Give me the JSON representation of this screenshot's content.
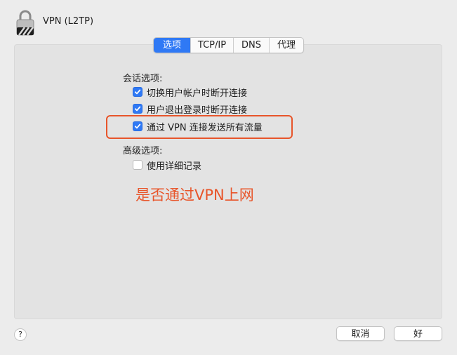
{
  "window": {
    "title": "VPN (L2TP)"
  },
  "tabs": [
    {
      "label": "选项",
      "active": true
    },
    {
      "label": "TCP/IP",
      "active": false
    },
    {
      "label": "DNS",
      "active": false
    },
    {
      "label": "代理",
      "active": false
    }
  ],
  "session_options": {
    "heading": "会话选项:",
    "items": [
      {
        "label": "切换用户帐户时断开连接",
        "checked": true
      },
      {
        "label": "用户退出登录时断开连接",
        "checked": true
      },
      {
        "label": "通过 VPN 连接发送所有流量",
        "checked": true
      }
    ]
  },
  "advanced_options": {
    "heading": "高级选项:",
    "items": [
      {
        "label": "使用详细记录",
        "checked": false
      }
    ]
  },
  "annotation": {
    "text": "是否通过VPN上网",
    "color": "#e8552a"
  },
  "footer": {
    "help_label": "?",
    "cancel_label": "取消",
    "ok_label": "好"
  },
  "colors": {
    "accent": "#2f79f5",
    "highlight": "#e8552a"
  }
}
